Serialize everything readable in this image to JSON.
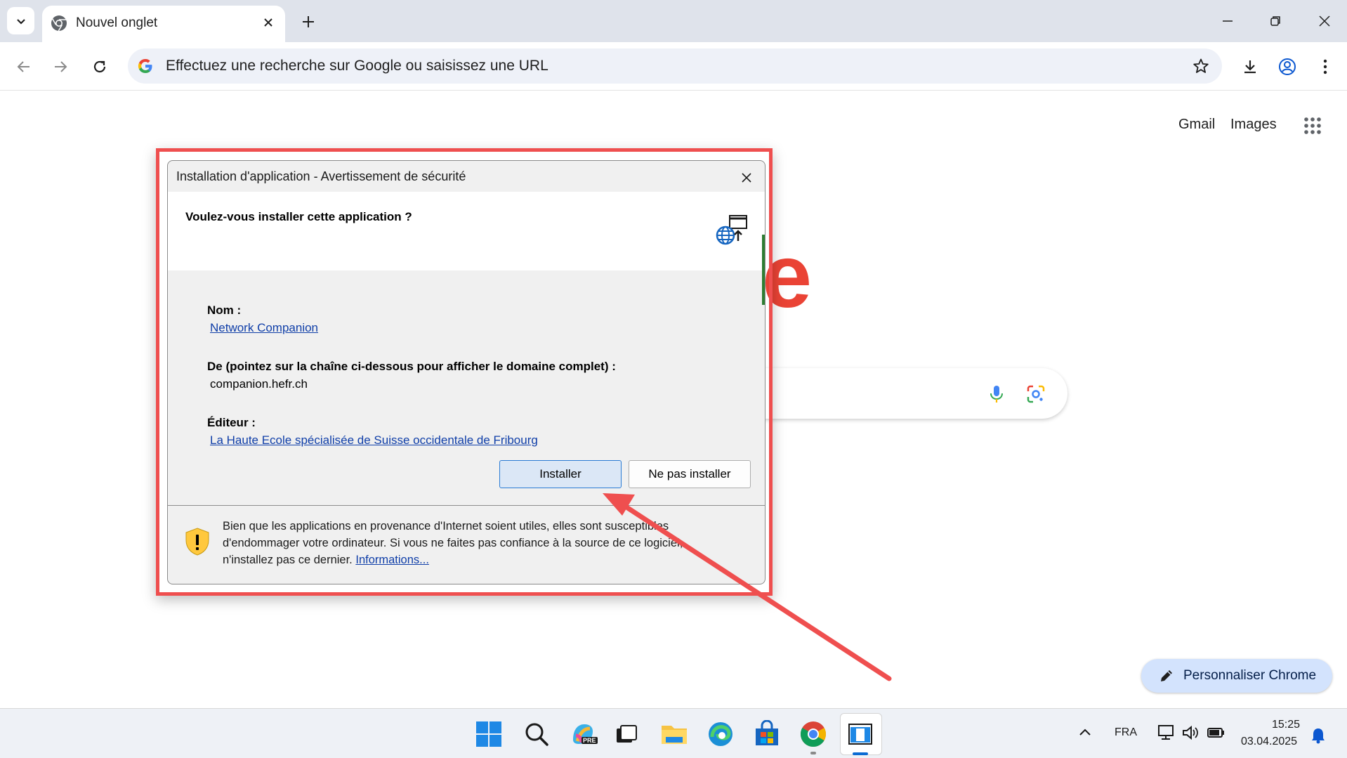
{
  "browser": {
    "tab_title": "Nouvel onglet",
    "omnibox_placeholder": "Effectuez une recherche sur Google ou saisissez une URL"
  },
  "newtab": {
    "gmail_link": "Gmail",
    "images_link": "Images",
    "logo_fragment": "e",
    "customize_label": "Personnaliser Chrome"
  },
  "dialog": {
    "title": "Installation d'application - Avertissement de sécurité",
    "question": "Voulez-vous installer cette application ?",
    "name_label": "Nom :",
    "name_value": "Network Companion",
    "from_label": "De (pointez sur la chaîne ci-dessous pour afficher le domaine complet) :",
    "from_value": "companion.hefr.ch",
    "publisher_label": "Éditeur :",
    "publisher_value": "La Haute Ecole spécialisée de Suisse occidentale de Fribourg",
    "install_button": "Installer",
    "cancel_button": "Ne pas installer",
    "warning_line1": "Bien que les applications en provenance d'Internet soient utiles, elles sont susceptibles",
    "warning_line2": "d'endommager votre ordinateur. Si vous ne faites pas confiance à la source de ce logiciel,",
    "warning_line3": "n'installez pas ce dernier.",
    "warning_link": "Informations..."
  },
  "taskbar": {
    "copilot_badge": "PRE",
    "language": "FRA",
    "time": "15:25",
    "date": "03.04.2025"
  },
  "colors": {
    "highlight_border": "#ef4f4f",
    "link": "#0f3ea8",
    "install_button_border": "#2a7bd5",
    "google_red": "#ea4335"
  }
}
